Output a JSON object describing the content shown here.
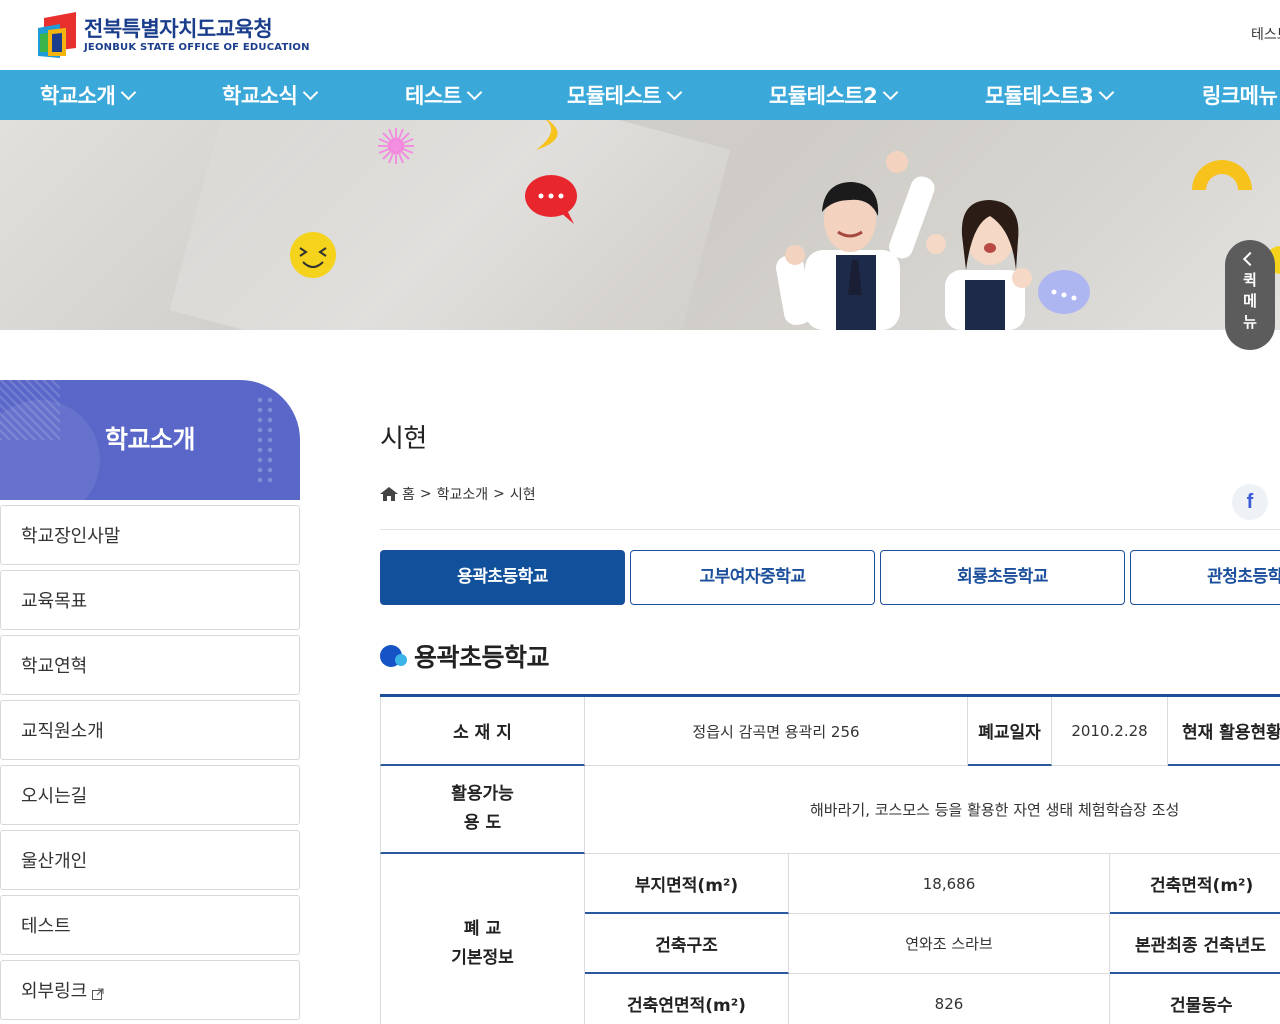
{
  "header": {
    "logo_ko": "전북특별자치도교육청",
    "logo_en": "JEONBUK STATE OFFICE OF EDUCATION",
    "util_text": "테스트"
  },
  "gnb": {
    "items": [
      {
        "label": "학교소개"
      },
      {
        "label": "학교소식"
      },
      {
        "label": "테스트"
      },
      {
        "label": "모듈테스트"
      },
      {
        "label": "모듈테스트2"
      },
      {
        "label": "모듈테스트3"
      },
      {
        "label": "링크메뉴"
      }
    ]
  },
  "quick_menu": {
    "label_1": "퀵",
    "label_2": "메",
    "label_3": "뉴"
  },
  "sidebar": {
    "title": "학교소개",
    "items": [
      {
        "label": "학교장인사말"
      },
      {
        "label": "교육목표"
      },
      {
        "label": "학교연혁"
      },
      {
        "label": "교직원소개"
      },
      {
        "label": "오시는길"
      },
      {
        "label": "울산개인"
      },
      {
        "label": "테스트"
      },
      {
        "label": "외부링크"
      }
    ]
  },
  "content": {
    "page_title": "시현",
    "breadcrumb": {
      "home": "홈",
      "sep": ">",
      "level1": "학교소개",
      "level2": "시현"
    },
    "facebook_glyph": "f",
    "tabs": [
      {
        "label": "용곽초등학교",
        "active": true
      },
      {
        "label": "고부여자중학교",
        "active": false
      },
      {
        "label": "회룡초등학교",
        "active": false
      },
      {
        "label": "관청초등학교",
        "active": false
      }
    ],
    "section_title": "용곽초등학교",
    "table": {
      "location_label": "소 재 지",
      "location_value": "정읍시 감곡면 용곽리 256",
      "closed_date_label": "폐교일자",
      "closed_date_value": "2010.2.28",
      "current_use_label": "현재 활용현황",
      "usable_label_1": "활용가능",
      "usable_label_2": "용 도",
      "usable_value": "해바라기, 코스모스 등을 활용한 자연 생태 체험학습장 조성",
      "basic_label_1": "폐 교",
      "basic_label_2": "기본정보",
      "land_area_label": "부지면적(m²)",
      "land_area_value": "18,686",
      "building_area_label": "건축면적(m²)",
      "structure_label": "건축구조",
      "structure_value": "연와조 스라브",
      "final_build_year_label": "본관최종 건축년도",
      "floor_area_label": "건축연면적(m²)",
      "floor_area_value": "826",
      "building_count_label": "건물동수"
    }
  },
  "colors": {
    "gnb_bg": "#3aa8d8",
    "primary_blue": "#11509a",
    "sidebar_head": "#5a67c8"
  }
}
